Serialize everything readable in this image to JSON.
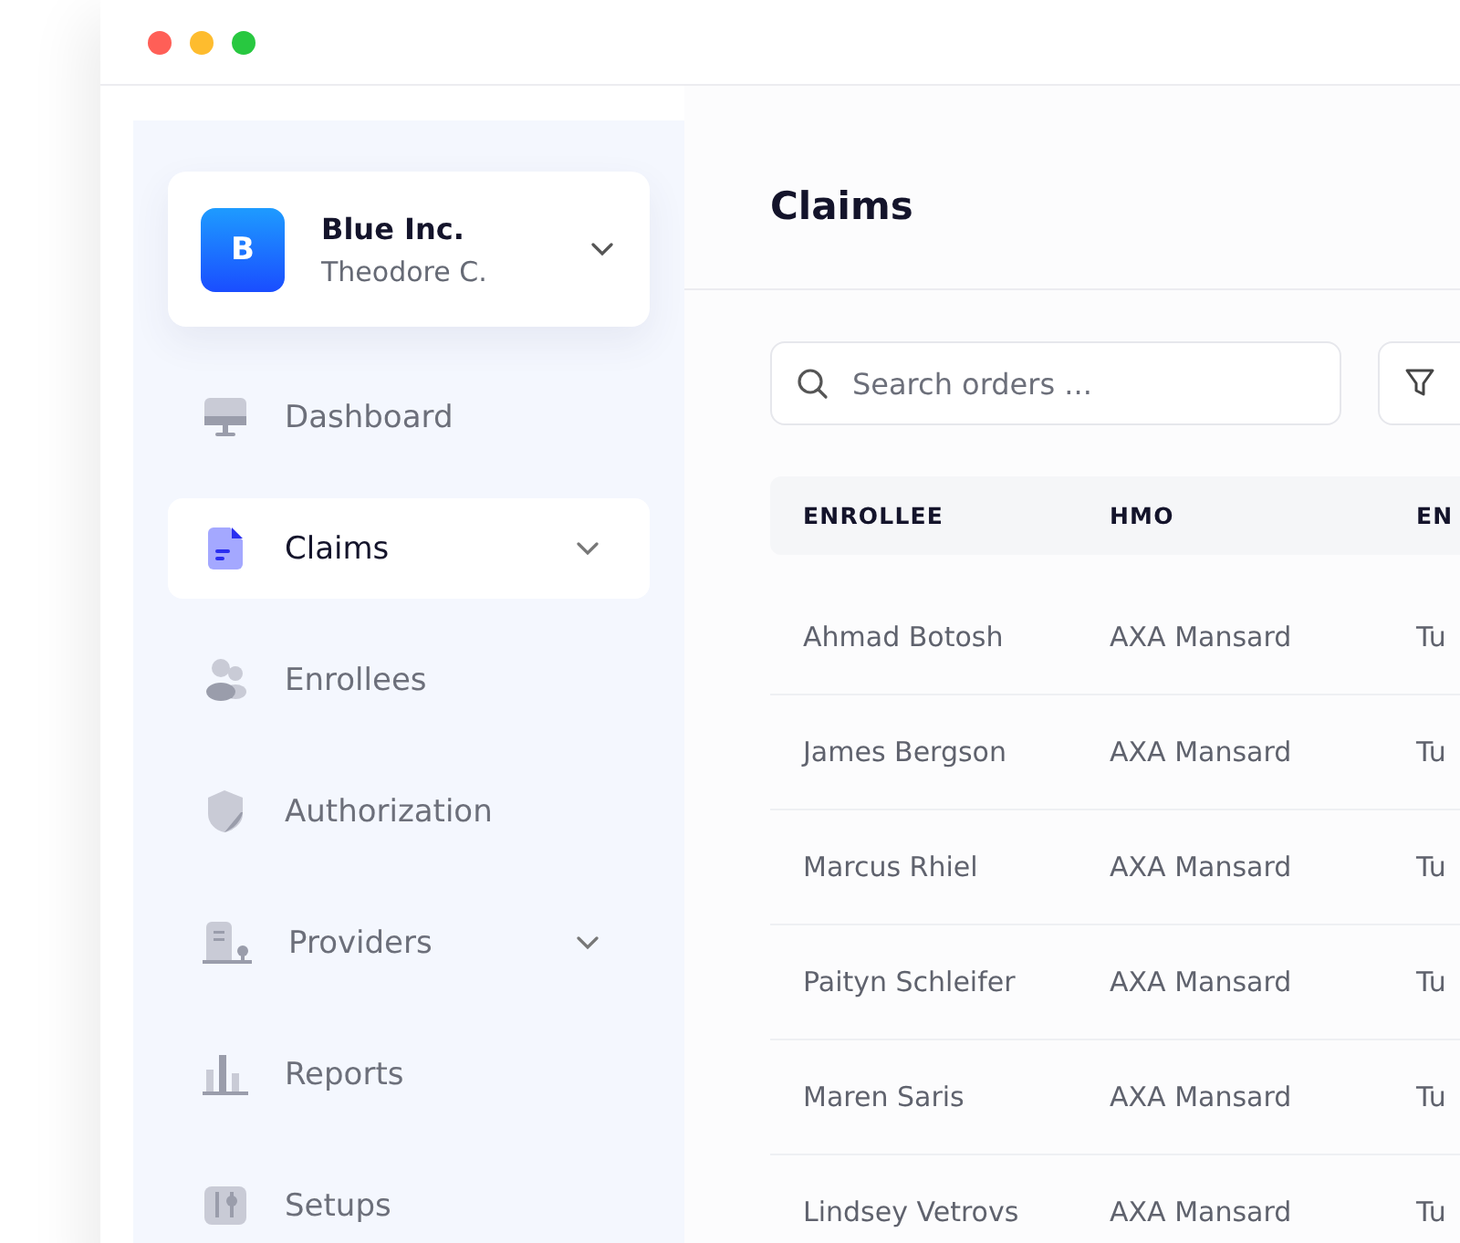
{
  "company": {
    "initial": "B",
    "name": "Blue Inc.",
    "user": "Theodore C."
  },
  "nav": [
    {
      "label": "Dashboard",
      "selected": false,
      "expandable": false
    },
    {
      "label": "Claims",
      "selected": true,
      "expandable": true
    },
    {
      "label": "Enrollees",
      "selected": false,
      "expandable": false
    },
    {
      "label": "Authorization",
      "selected": false,
      "expandable": false
    },
    {
      "label": "Providers",
      "selected": false,
      "expandable": true
    },
    {
      "label": "Reports",
      "selected": false,
      "expandable": false
    },
    {
      "label": "Setups",
      "selected": false,
      "expandable": false
    }
  ],
  "page_title": "Claims",
  "search": {
    "placeholder": "Search orders ..."
  },
  "table": {
    "columns": [
      "ENROLLEE",
      "HMO",
      "EN"
    ],
    "rows": [
      [
        "Ahmad Botosh",
        "AXA Mansard",
        "Tu"
      ],
      [
        "James Bergson",
        "AXA Mansard",
        "Tu"
      ],
      [
        "Marcus Rhiel",
        "AXA Mansard",
        "Tu"
      ],
      [
        "Paityn Schleifer",
        "AXA Mansard",
        "Tu"
      ],
      [
        "Maren Saris",
        "AXA Mansard",
        "Tu"
      ],
      [
        "Lindsey Vetrovs",
        "AXA Mansard",
        "Tu"
      ]
    ]
  }
}
